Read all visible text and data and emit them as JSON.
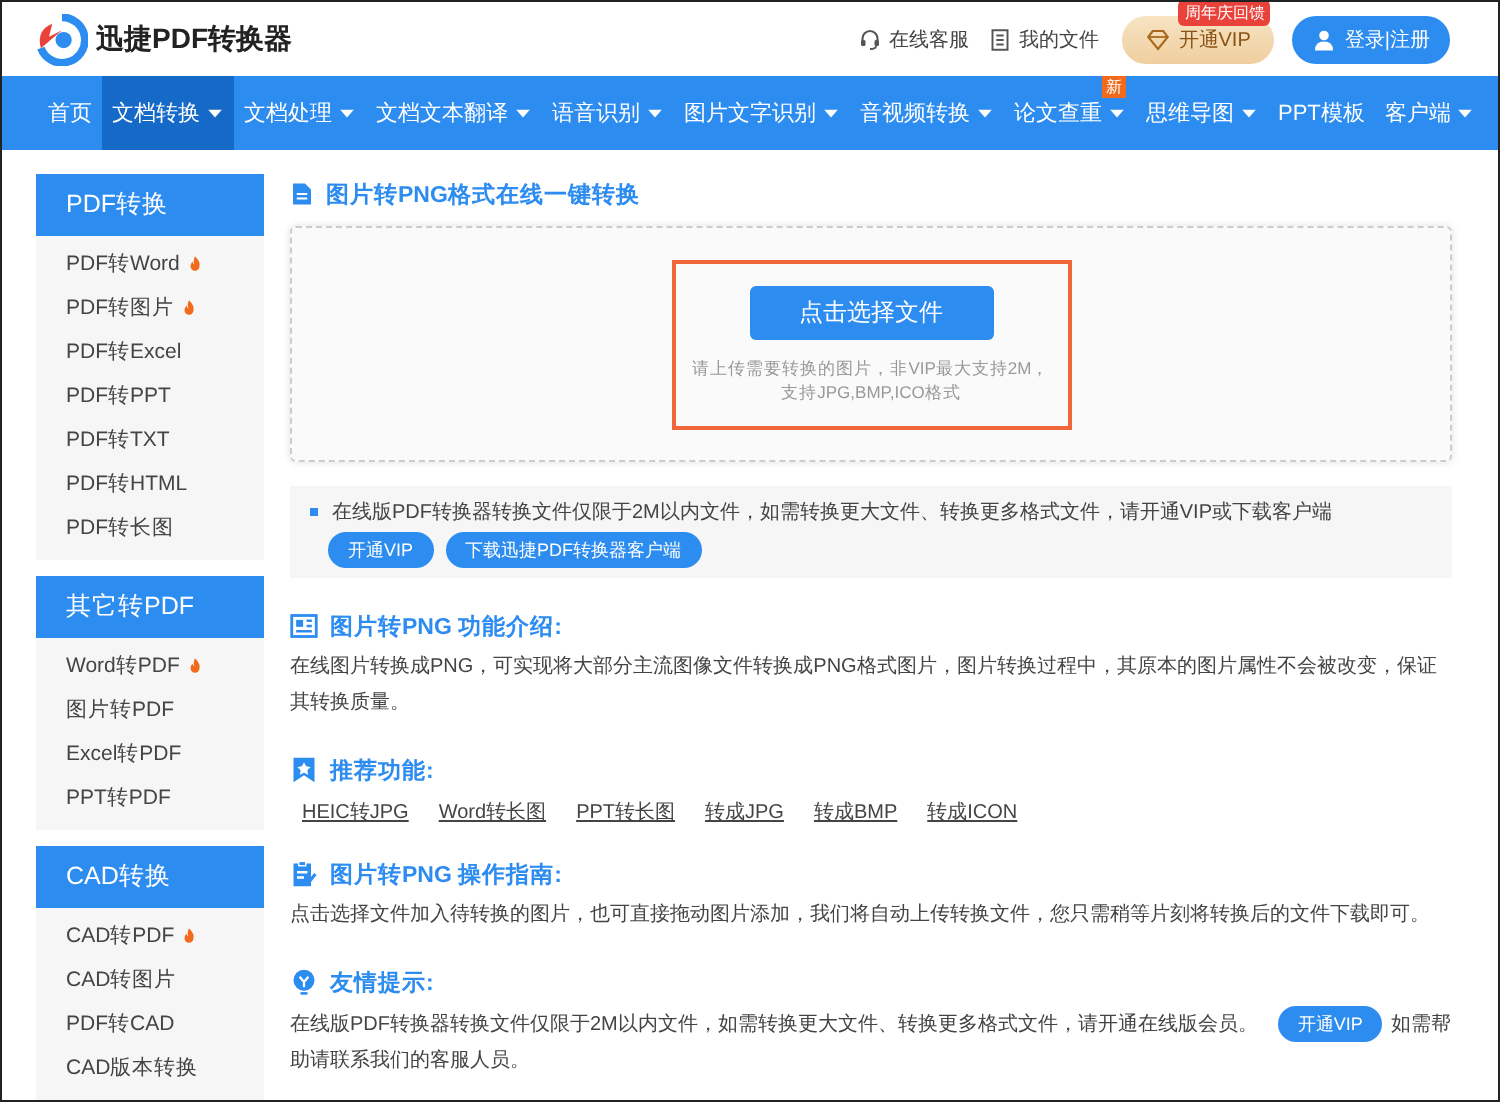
{
  "header": {
    "brand": "迅捷PDF转换器",
    "links": [
      {
        "kind": "service",
        "label": "在线客服"
      },
      {
        "kind": "files",
        "label": "我的文件"
      }
    ],
    "vip_button": {
      "label": "开通VIP",
      "badge": "周年庆回馈"
    },
    "login_button": "登录|注册"
  },
  "nav": [
    {
      "label": "首页",
      "dropdown": false,
      "selected": false
    },
    {
      "label": "文档转换",
      "dropdown": true,
      "selected": true
    },
    {
      "label": "文档处理",
      "dropdown": true,
      "selected": false
    },
    {
      "label": "文档文本翻译",
      "dropdown": true,
      "selected": false
    },
    {
      "label": "语音识别",
      "dropdown": true,
      "selected": false
    },
    {
      "label": "图片文字识别",
      "dropdown": true,
      "selected": false
    },
    {
      "label": "音视频转换",
      "dropdown": true,
      "selected": false
    },
    {
      "label": "论文查重",
      "dropdown": true,
      "selected": false,
      "badge": "新"
    },
    {
      "label": "思维导图",
      "dropdown": true,
      "selected": false
    },
    {
      "label": "PPT模板",
      "dropdown": false,
      "selected": false
    },
    {
      "label": "客户端",
      "dropdown": true,
      "selected": false
    }
  ],
  "sidebar": [
    {
      "title": "PDF转换",
      "items": [
        {
          "label": "PDF转Word",
          "hot": true
        },
        {
          "label": "PDF转图片",
          "hot": true
        },
        {
          "label": "PDF转Excel",
          "hot": false
        },
        {
          "label": "PDF转PPT",
          "hot": false
        },
        {
          "label": "PDF转TXT",
          "hot": false
        },
        {
          "label": "PDF转HTML",
          "hot": false
        },
        {
          "label": "PDF转长图",
          "hot": false
        }
      ]
    },
    {
      "title": "其它转PDF",
      "items": [
        {
          "label": "Word转PDF",
          "hot": true
        },
        {
          "label": "图片转PDF",
          "hot": false
        },
        {
          "label": "Excel转PDF",
          "hot": false
        },
        {
          "label": "PPT转PDF",
          "hot": false
        }
      ]
    },
    {
      "title": "CAD转换",
      "items": [
        {
          "label": "CAD转PDF",
          "hot": true
        },
        {
          "label": "CAD转图片",
          "hot": false
        },
        {
          "label": "PDF转CAD",
          "hot": false
        },
        {
          "label": "CAD版本转换",
          "hot": false
        }
      ]
    }
  ],
  "upload": {
    "title": "图片转PNG格式在线一键转换",
    "button": "点击选择文件",
    "hint_lines": [
      "请上传需要转换的图片，非VIP最大支持2M，",
      "支持JPG,BMP,ICO格式"
    ],
    "highlighted": true
  },
  "notice": {
    "text": "在线版PDF转换器转换文件仅限于2M以内文件，如需转换更大文件、转换更多格式文件，请开通VIP或下载客户端",
    "buttons": [
      "开通VIP",
      "下载迅捷PDF转换器客户端"
    ]
  },
  "sections": [
    {
      "kind": "intro",
      "title": "图片转PNG 功能介绍:",
      "text": "在线图片转换成PNG，可实现将大部分主流图像文件转换成PNG格式图片，图片转换过程中，其原本的图片属性不会被改变，保证其转换质量。"
    },
    {
      "kind": "recommend",
      "title": "推荐功能:",
      "links": [
        "HEIC转JPG",
        "Word转长图",
        "PPT转长图",
        "转成JPG",
        "转成BMP",
        "转成ICON"
      ]
    },
    {
      "kind": "guide",
      "title": "图片转PNG 操作指南:",
      "text": "点击选择文件加入待转换的图片，也可直接拖动图片添加，我们将自动上传转换文件，您只需稍等片刻将转换后的文件下载即可。"
    },
    {
      "kind": "tip",
      "title": "友情提示:",
      "text_before": "在线版PDF转换器转换文件仅限于2M以内文件，如需转换更大文件、转换更多格式文件，请开通在线版会员。",
      "button": "开通VIP",
      "text_after": "如需帮助请联系我们的客服人员。"
    }
  ]
}
